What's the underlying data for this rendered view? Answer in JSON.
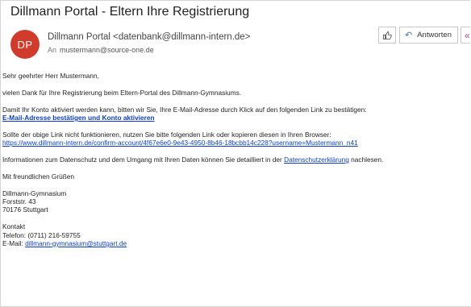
{
  "header": {
    "subject": "Dillmann Portal - Eltern Ihre Registrierung",
    "avatar_initials": "DP",
    "avatar_color": "#d13b2b",
    "sender": "Dillmann Portal <datenbank@dillmann-intern.de>",
    "to_label": "An",
    "to_address": "mustermann@source-one.de"
  },
  "toolbar": {
    "like_icon": "thumbs-up-icon",
    "reply_label": "Antworten",
    "reply_icon": "reply-arrow-icon",
    "more_icon": "reply-all-icon"
  },
  "body": {
    "greeting": "Sehr geehrter Herr Mustermann,",
    "thanks": "vielen Dank für Ihre Registrierung beim Eltern-Portal des Dillmann-Gymnasiums.",
    "activation_text": "Damit Ihr Konto aktiviert werden kann, bitten wir Sie, Ihre E-Mail-Adresse durch Klick auf den folgenden Link zu bestätigen:",
    "activation_link": "E-Mail-Adresse bestätigen und Konto aktivieren",
    "fallback_text": "Sollte der obige Link nicht funktionieren, nutzen Sie bitte folgenden Link oder kopieren diesen in Ihren Browser:",
    "fallback_url": "https://www.dillmann-intern.de/confirm-account/4f67e6e0-9e43-4950-8b46-18bcbb14c228?username=Mustermann_n41",
    "privacy_before": "Informationen zum Datenschutz und dem Umgang mit Ihren Daten können Sie detailliert in der ",
    "privacy_link": "Datenschutzerklärung",
    "privacy_after": " nachlesen.",
    "closing": "Mit freundlichen Grüßen",
    "address_name": "Dillmann-Gymnasium",
    "address_street": "Forststr. 43",
    "address_city": "70176 Stuttgart",
    "contact_heading": "Kontakt",
    "contact_phone": "Telefon: (0711) 216-59755",
    "contact_email_label": "E-Mail: ",
    "contact_email": "dillmann-gymnasium@stuttgart.de"
  },
  "colors": {
    "link": "#0b3fc7",
    "reply_icon": "#4a6fc2"
  }
}
